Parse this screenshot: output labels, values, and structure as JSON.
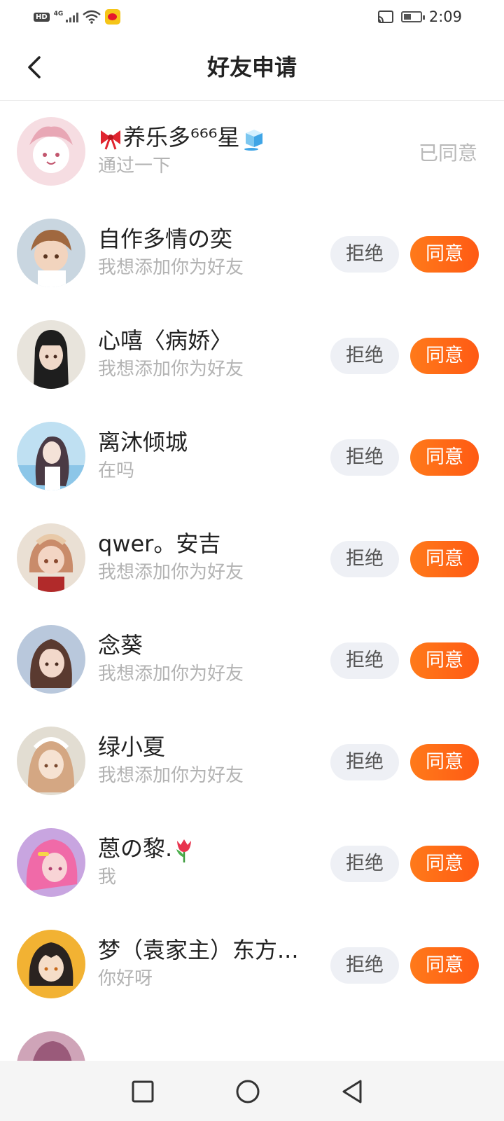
{
  "status_bar": {
    "hd": "HD",
    "network": "4G",
    "time": "2:09"
  },
  "header": {
    "title": "好友申请"
  },
  "requests": [
    {
      "name": "养乐多⁶⁶⁶星",
      "message": "通过一下",
      "status": "已同意",
      "avatar_colors": [
        "#f6dde2",
        "#ffffff",
        "#e8a7b5"
      ]
    },
    {
      "name": "自作多情の奕",
      "message": "我想添加你为好友",
      "reject_label": "拒绝",
      "accept_label": "同意",
      "avatar_colors": [
        "#c9d6e0",
        "#a0683f",
        "#f2d4be"
      ]
    },
    {
      "name": "心嘻〈病娇〉",
      "message": "我想添加你为好友",
      "reject_label": "拒绝",
      "accept_label": "同意",
      "avatar_colors": [
        "#e8e4dc",
        "#1e1e1e",
        "#f0d9c9"
      ]
    },
    {
      "name": "离沐倾城",
      "message": "在吗",
      "reject_label": "拒绝",
      "accept_label": "同意",
      "avatar_colors": [
        "#bfe0f2",
        "#4a3a44",
        "#f4e2d8"
      ]
    },
    {
      "name": "qwer。安吉",
      "message": "我想添加你为好友",
      "reject_label": "拒绝",
      "accept_label": "同意",
      "avatar_colors": [
        "#eae0d4",
        "#c98b6a",
        "#f3d5c4"
      ]
    },
    {
      "name": "念葵",
      "message": "我想添加你为好友",
      "reject_label": "拒绝",
      "accept_label": "同意",
      "avatar_colors": [
        "#b9c8dc",
        "#5a3a30",
        "#f2d8ca"
      ]
    },
    {
      "name": "绿小夏",
      "message": "我想添加你为好友",
      "reject_label": "拒绝",
      "accept_label": "同意",
      "avatar_colors": [
        "#e2ddd2",
        "#d4a783",
        "#f6e2d2"
      ]
    },
    {
      "name": "蒽の黎.",
      "message": "我",
      "reject_label": "拒绝",
      "accept_label": "同意",
      "avatar_colors": [
        "#c8a5e0",
        "#f06aa8",
        "#f8d4d6"
      ]
    },
    {
      "name": "梦（袁家主）东方...",
      "message": "你好呀",
      "reject_label": "拒绝",
      "accept_label": "同意",
      "avatar_colors": [
        "#f2b233",
        "#2a2320",
        "#f5ddc8"
      ]
    }
  ],
  "colors": {
    "accent": "#ff6a17",
    "reject_bg": "#eef0f5",
    "secondary_text": "#b3b3b3"
  },
  "icons": {
    "back": "back-arrow-icon",
    "nav_recent": "square-icon",
    "nav_home": "circle-icon",
    "nav_back": "triangle-back-icon"
  }
}
